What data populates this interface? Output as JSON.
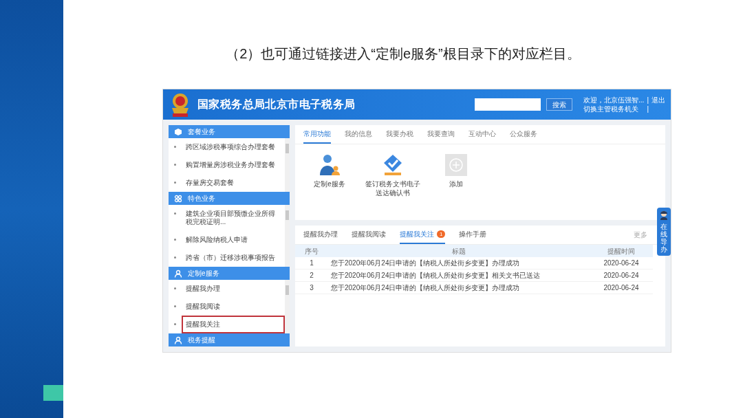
{
  "slide": {
    "heading": "（2）也可通过链接进入“定制e服务”根目录下的对应栏目。"
  },
  "site": {
    "title": "国家税务总局北京市电子税务局",
    "search_button": "搜索",
    "welcome": "欢迎，北京伍强智...",
    "separator_1": "|",
    "logout": "退出",
    "switch_office": "切换主管税务机关",
    "separator_2": "|"
  },
  "sidebar": {
    "sections": [
      {
        "title": "套餐业务",
        "kind": "package",
        "items": [
          {
            "label": "跨区域涉税事项综合办理套餐",
            "highlighted": false
          },
          {
            "label": "购置增量房涉税业务办理套餐",
            "highlighted": false
          },
          {
            "label": "存量房交易套餐",
            "highlighted": false
          }
        ]
      },
      {
        "title": "特色业务",
        "kind": "feature",
        "items": [
          {
            "label": "建筑企业项目部预缴企业所得税完税证明...",
            "highlighted": false
          },
          {
            "label": "解除风险纳税人申请",
            "highlighted": false
          },
          {
            "label": "跨省（市）迁移涉税事项报告",
            "highlighted": false
          }
        ]
      },
      {
        "title": "定制e服务",
        "kind": "user",
        "items": [
          {
            "label": "提醒我办理",
            "highlighted": false
          },
          {
            "label": "提醒我阅读",
            "highlighted": false
          },
          {
            "label": "提醒我关注",
            "highlighted": true
          }
        ]
      },
      {
        "title": "税务提醒",
        "kind": "user"
      }
    ]
  },
  "top_panel": {
    "tabs": [
      {
        "label": "常用功能",
        "selected": true
      },
      {
        "label": "我的信息",
        "selected": false
      },
      {
        "label": "我要办税",
        "selected": false
      },
      {
        "label": "我要查询",
        "selected": false
      },
      {
        "label": "互动中心",
        "selected": false
      },
      {
        "label": "公众服务",
        "selected": false
      }
    ],
    "shortcuts": [
      {
        "label": "定制e服务",
        "kind": "user"
      },
      {
        "label": "签订税务文书电子送达确认书",
        "kind": "check"
      },
      {
        "label": "添加",
        "kind": "add"
      }
    ]
  },
  "reminders": {
    "tabs": [
      {
        "label": "提醒我办理",
        "selected": false
      },
      {
        "label": "提醒我阅读",
        "selected": false
      },
      {
        "label": "提醒我关注",
        "selected": true,
        "badge": "1"
      },
      {
        "label": "操作手册",
        "selected": false
      }
    ],
    "more": "更多",
    "columns": [
      "序号",
      "标题",
      "提醒时间"
    ],
    "rows": [
      [
        "1",
        "您于2020年06月24日申请的【纳税人所处街乡变更】办理成功",
        "2020-06-24"
      ],
      [
        "2",
        "您于2020年06月24日申请的【纳税人所处街乡变更】相关文书已送达",
        "2020-06-24"
      ],
      [
        "3",
        "您于2020年06月24日申请的【纳税人所处街乡变更】办理成功",
        "2020-06-24"
      ]
    ]
  },
  "floating_guide": {
    "label": "在线导办"
  }
}
